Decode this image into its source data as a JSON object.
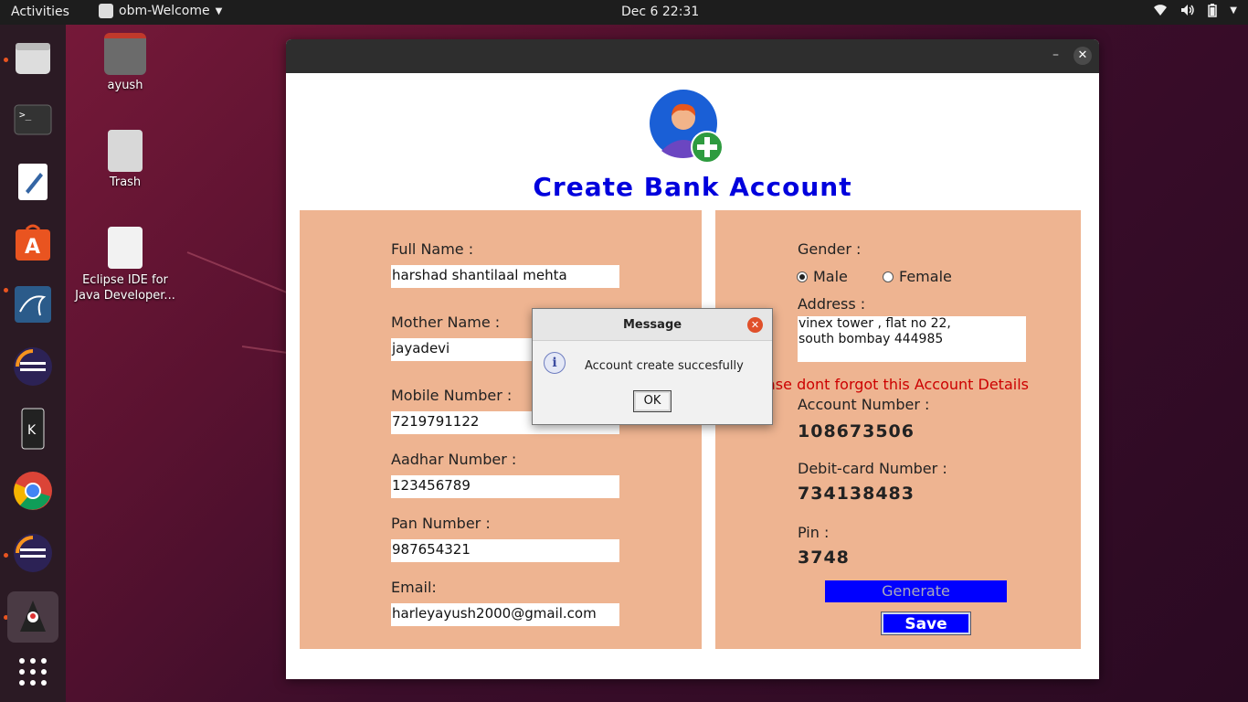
{
  "topbar": {
    "activities": "Activities",
    "app_name": "obm-Welcome",
    "clock": "Dec 6  22:31"
  },
  "desktop_icons": [
    {
      "name": "home-folder",
      "label": "ayush"
    },
    {
      "name": "trash",
      "label": "Trash"
    },
    {
      "name": "eclipse-launcher",
      "label": "Eclipse IDE for Java Developer..."
    }
  ],
  "dock": {
    "items": [
      "files",
      "terminal",
      "text-editor",
      "software-center",
      "mysql-workbench",
      "eclipse",
      "kde-connect",
      "chrome",
      "eclipse-2",
      "java-app",
      "show-apps"
    ]
  },
  "window": {
    "minimize": "–",
    "close": "✕"
  },
  "form": {
    "title": "Create Bank Account",
    "full_name_label": "Full Name :",
    "full_name_value": "harshad shantilaal mehta",
    "mother_name_label": "Mother Name :",
    "mother_name_value": "jayadevi",
    "mobile_label": "Mobile Number :",
    "mobile_value": "7219791122",
    "aadhar_label": "Aadhar Number :",
    "aadhar_value": "123456789",
    "pan_label": "Pan Number :",
    "pan_value": "987654321",
    "email_label": "Email:",
    "email_value": "harleyayush2000@gmail.com",
    "gender_label": "Gender :",
    "gender_male": "Male",
    "gender_female": "Female",
    "gender_selected": "Male",
    "address_label": "Address :",
    "address_line1": "vinex tower , flat no 22,",
    "address_line2": "south bombay 444985",
    "warning": "ase dont forgot this Account Details",
    "account_number_label": "Account Number :",
    "account_number_value": "108673506",
    "debit_card_label": "Debit-card Number :",
    "debit_card_value": "734138483",
    "pin_label": "Pin :",
    "pin_value": "3748",
    "generate_button": "Generate",
    "save_button": "Save"
  },
  "dialog": {
    "title": "Message",
    "message": "Account create succesfully",
    "ok_button": "OK",
    "close": "✕",
    "info_icon": "i"
  },
  "colors": {
    "title_blue": "#0000dd",
    "panel_bg": "#eeb491",
    "warning_red": "#cc0000",
    "button_blue": "#0000ff",
    "ubuntu_orange": "#e95420"
  }
}
